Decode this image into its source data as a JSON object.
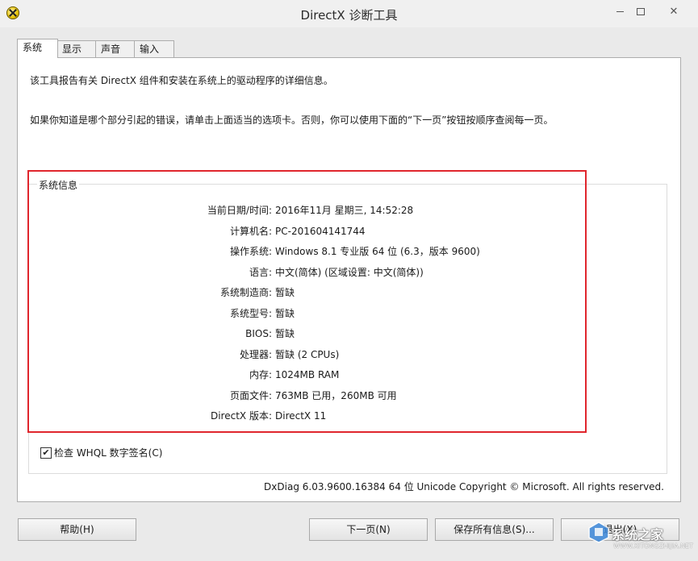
{
  "window": {
    "title": "DirectX 诊断工具",
    "controls": {
      "close": "✕"
    }
  },
  "tabs": [
    {
      "label": "系统",
      "active": true
    },
    {
      "label": "显示",
      "active": false
    },
    {
      "label": "声音",
      "active": false
    },
    {
      "label": "输入",
      "active": false
    }
  ],
  "intro": {
    "line1": "该工具报告有关 DirectX 组件和安装在系统上的驱动程序的详细信息。",
    "line2": "如果你知道是哪个部分引起的错误，请单击上面适当的选项卡。否则，你可以使用下面的“下一页”按钮按顺序查阅每一页。"
  },
  "system_info": {
    "group_label": "系统信息",
    "rows": [
      {
        "label": "当前日期/时间:",
        "value": "2016年11月 星期三, 14:52:28"
      },
      {
        "label": "计算机名:",
        "value": "PC-201604141744"
      },
      {
        "label": "操作系统:",
        "value": "Windows 8.1 专业版 64 位 (6.3，版本 9600)"
      },
      {
        "label": "语言:",
        "value": "中文(简体) (区域设置: 中文(简体))"
      },
      {
        "label": "系统制造商:",
        "value": "暂缺"
      },
      {
        "label": "系统型号:",
        "value": "暂缺"
      },
      {
        "label": "BIOS:",
        "value": "暂缺"
      },
      {
        "label": "处理器:",
        "value": "暂缺 (2 CPUs)"
      },
      {
        "label": "内存:",
        "value": "1024MB RAM"
      },
      {
        "label": "页面文件:",
        "value": "763MB 已用，260MB 可用"
      },
      {
        "label": "DirectX 版本:",
        "value": "DirectX 11"
      }
    ]
  },
  "whql_check": {
    "label": "检查 WHQL 数字签名(C)",
    "checked": true,
    "mark": "✔"
  },
  "version_line": "DxDiag 6.03.9600.16384 64 位 Unicode  Copyright © Microsoft. All rights reserved.",
  "buttons": {
    "help": "帮助(H)",
    "next": "下一页(N)",
    "save": "保存所有信息(S)...",
    "exit": "退出(X)"
  },
  "watermark": {
    "text": "系统之家",
    "url": "WWW.XITONGZHIJIA.NET"
  },
  "colors": {
    "highlight_frame": "#e0262d",
    "window_bg": "#eaeaea",
    "panel_bg": "#ffffff"
  }
}
